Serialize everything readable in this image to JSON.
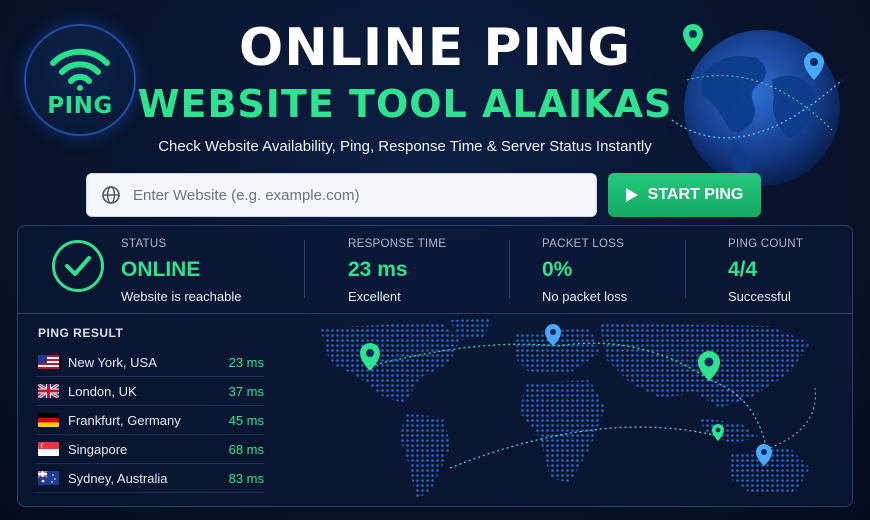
{
  "header": {
    "logo_text": "PING",
    "title_line1": "ONLINE PING",
    "title_line2": "WEBSITE TOOL ALAIKAS",
    "subtitle": "Check Website Availability, Ping, Response Time & Server Status Instantly"
  },
  "search": {
    "placeholder": "Enter Website (e.g. example.com)",
    "value": "",
    "button_label": "START PING"
  },
  "stats": [
    {
      "label": "STATUS",
      "value": "ONLINE",
      "sub": "Website is reachable"
    },
    {
      "label": "RESPONSE TIME",
      "value": "23 ms",
      "sub": "Excellent"
    },
    {
      "label": "PACKET LOSS",
      "value": "0%",
      "sub": "No packet loss"
    },
    {
      "label": "PING COUNT",
      "value": "4/4",
      "sub": "Successful"
    }
  ],
  "results": {
    "title": "PING RESULT",
    "rows": [
      {
        "location": "New York, USA",
        "time": "23 ms",
        "flag": "us-flag-icon"
      },
      {
        "location": "London, UK",
        "time": "37 ms",
        "flag": "uk-flag-icon"
      },
      {
        "location": "Frankfurt, Germany",
        "time": "45 ms",
        "flag": "de-flag-icon"
      },
      {
        "location": "Singapore",
        "time": "68 ms",
        "flag": "sg-flag-icon"
      },
      {
        "location": "Sydney, Australia",
        "time": "83 ms",
        "flag": "au-flag-icon"
      }
    ]
  },
  "colors": {
    "background": "#08142e",
    "accent_green": "#2fe28f",
    "panel_border": "#2a3f6a",
    "map_dots": "#2a66c9",
    "pin_blue": "#4aa8ff"
  }
}
